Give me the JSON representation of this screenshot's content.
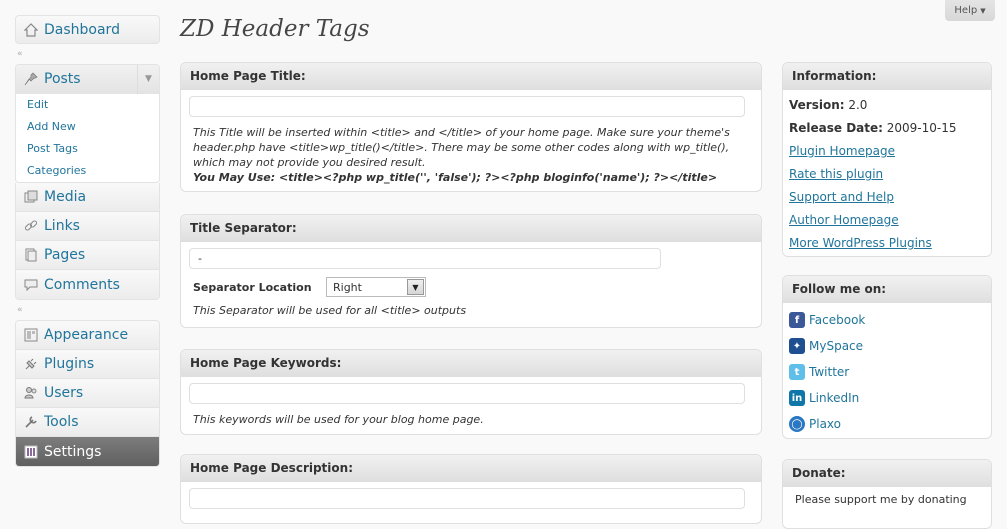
{
  "help": {
    "label": "Help"
  },
  "page": {
    "title": "ZD Header Tags"
  },
  "menu": {
    "dashboard": "Dashboard",
    "posts": "Posts",
    "posts_sub": [
      "Edit",
      "Add New",
      "Post Tags",
      "Categories"
    ],
    "media": "Media",
    "links": "Links",
    "pages": "Pages",
    "comments": "Comments",
    "appearance": "Appearance",
    "plugins": "Plugins",
    "users": "Users",
    "tools": "Tools",
    "settings": "Settings"
  },
  "home_title": {
    "heading": "Home Page Title:",
    "value": "",
    "desc": "This Title will be inserted within <title> and </title> of your home page. Make sure your theme's header.php have <title>wp_title()</title>. There may be some other codes along with wp_title(), which may not provide you desired result.",
    "use": "You May Use: <title><?php wp_title('', 'false'); ?><?php bloginfo('name'); ?></title>"
  },
  "separator": {
    "heading": "Title Separator:",
    "value": "-",
    "location_label": "Separator Location",
    "location_value": "Right",
    "desc": "This Separator will be used for all <title> outputs"
  },
  "keywords": {
    "heading": "Home Page Keywords:",
    "value": "",
    "desc": "This keywords will be used for your blog home page."
  },
  "description": {
    "heading": "Home Page Description:",
    "value": ""
  },
  "info": {
    "heading": "Information:",
    "version_label": "Version:",
    "version": "2.0",
    "release_label": "Release Date:",
    "release": "2009-10-15",
    "links": [
      "Plugin Homepage",
      "Rate this plugin",
      "Support and Help",
      "Author Homepage",
      "More WordPress Plugins"
    ]
  },
  "follow": {
    "heading": "Follow me on:",
    "items": [
      "Facebook",
      "MySpace",
      "Twitter",
      "LinkedIn",
      "Plaxo"
    ]
  },
  "donate": {
    "heading": "Donate:",
    "text": "Please support me by donating"
  },
  "colors": {
    "link": "#21759b",
    "current_menu": "#6d6d6d"
  }
}
